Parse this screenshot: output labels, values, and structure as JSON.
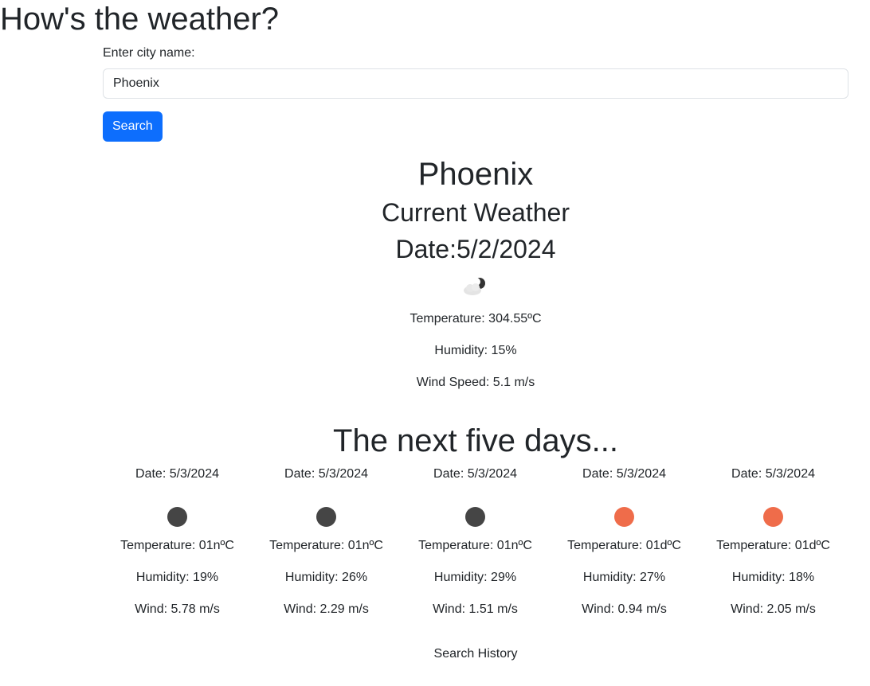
{
  "header": {
    "title": "How's the weather?"
  },
  "search": {
    "label": "Enter city name:",
    "value": "Phoenix",
    "button_label": "Search",
    "button_color": "#0d6efd"
  },
  "current": {
    "city": "Phoenix",
    "heading": "Current Weather",
    "date": "Date:5/2/2024",
    "icon": "cloud-moon-icon",
    "temperature": "Temperature: 304.55ºC",
    "humidity": "Humidity: 15%",
    "wind": "Wind Speed: 5.1 m/s"
  },
  "forecast": {
    "title": "The next five days...",
    "days": [
      {
        "date": "Date: 5/3/2024",
        "icon": "night-dot-icon",
        "icon_color": "#454545",
        "temperature": "Temperature: 01nºC",
        "humidity": "Humidity: 19%",
        "wind": "Wind: 5.78 m/s"
      },
      {
        "date": "Date: 5/3/2024",
        "icon": "night-dot-icon",
        "icon_color": "#454545",
        "temperature": "Temperature: 01nºC",
        "humidity": "Humidity: 26%",
        "wind": "Wind: 2.29 m/s"
      },
      {
        "date": "Date: 5/3/2024",
        "icon": "night-dot-icon",
        "icon_color": "#454545",
        "temperature": "Temperature: 01nºC",
        "humidity": "Humidity: 29%",
        "wind": "Wind: 1.51 m/s"
      },
      {
        "date": "Date: 5/3/2024",
        "icon": "sun-dot-icon",
        "icon_color": "#ef6c4a",
        "temperature": "Temperature: 01dºC",
        "humidity": "Humidity: 27%",
        "wind": "Wind: 0.94 m/s"
      },
      {
        "date": "Date: 5/3/2024",
        "icon": "sun-dot-icon",
        "icon_color": "#ef6c4a",
        "temperature": "Temperature: 01dºC",
        "humidity": "Humidity: 18%",
        "wind": "Wind: 2.05 m/s"
      }
    ]
  },
  "history": {
    "label": "Search History"
  }
}
